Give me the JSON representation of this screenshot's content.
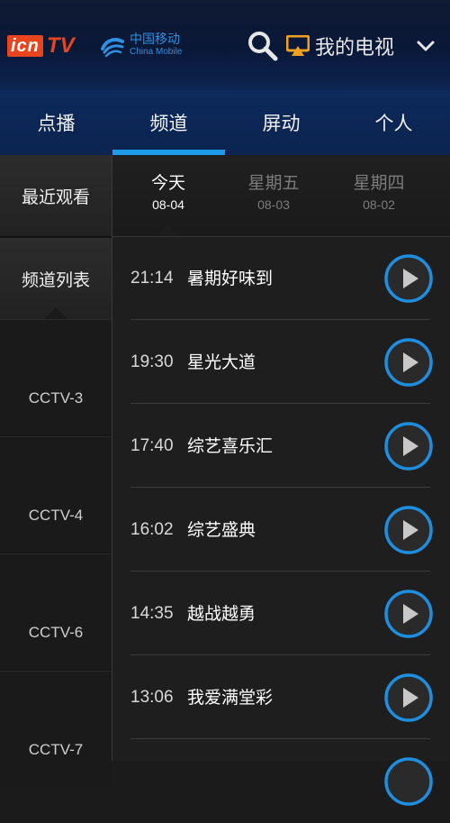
{
  "header": {
    "logo_box": "icn",
    "logo_tv": "TV",
    "carrier_cn": "中国移动",
    "carrier_en": "China Mobile",
    "my_tv_label": "我的电视",
    "icons": [
      "search-icon",
      "cast-icon",
      "chevron-down-icon"
    ],
    "accent_color": "#e8451e"
  },
  "tabs": [
    {
      "label": "点播",
      "active": false
    },
    {
      "label": "频道",
      "active": true
    },
    {
      "label": "屏动",
      "active": false
    },
    {
      "label": "个人",
      "active": false
    }
  ],
  "sidebar": {
    "recent_label": "最近观看",
    "channel_list_label": "频道列表",
    "channels": [
      "CCTV-3",
      "CCTV-4",
      "CCTV-6",
      "CCTV-7"
    ]
  },
  "days": [
    {
      "name": "今天",
      "date": "08-04",
      "active": true
    },
    {
      "name": "星期五",
      "date": "08-03",
      "active": false
    },
    {
      "name": "星期四",
      "date": "08-02",
      "active": false
    }
  ],
  "programs": [
    {
      "time": "21:14",
      "title": "暑期好味到"
    },
    {
      "time": "19:30",
      "title": "星光大道"
    },
    {
      "time": "17:40",
      "title": "综艺喜乐汇"
    },
    {
      "time": "16:02",
      "title": "综艺盛典"
    },
    {
      "time": "14:35",
      "title": "越战越勇"
    },
    {
      "time": "13:06",
      "title": "我爱满堂彩"
    }
  ],
  "colors": {
    "highlight": "#1e9be8",
    "play_ring": "#1e8fe0"
  }
}
